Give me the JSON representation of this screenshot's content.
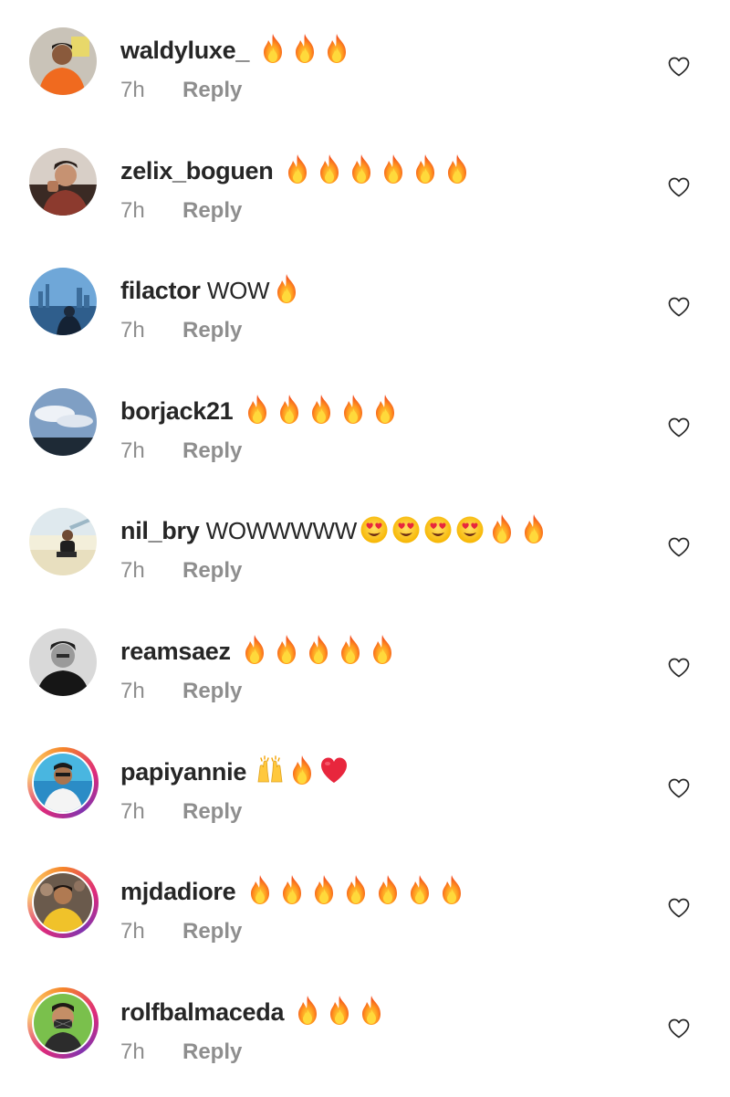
{
  "heart_color": "#262626",
  "muted_color": "#8e8e8e",
  "comments": [
    {
      "username": "waldyluxe_",
      "text": "",
      "emojis": [
        "fire",
        "fire",
        "fire"
      ],
      "time": "7h",
      "reply": "Reply",
      "story": false
    },
    {
      "username": "zelix_boguen",
      "text": "",
      "emojis": [
        "fire",
        "fire",
        "fire",
        "fire",
        "fire",
        "fire"
      ],
      "time": "7h",
      "reply": "Reply",
      "story": false
    },
    {
      "username": "filactor",
      "text": "WOW",
      "emojis": [
        "fire"
      ],
      "time": "7h",
      "reply": "Reply",
      "story": false
    },
    {
      "username": "borjack21",
      "text": "",
      "emojis": [
        "fire",
        "fire",
        "fire",
        "fire",
        "fire"
      ],
      "time": "7h",
      "reply": "Reply",
      "story": false
    },
    {
      "username": "nil_bry",
      "text": "WOWWWWW",
      "emojis": [
        "heart-eyes",
        "heart-eyes",
        "heart-eyes",
        "heart-eyes",
        "fire",
        "fire"
      ],
      "time": "7h",
      "reply": "Reply",
      "story": false
    },
    {
      "username": "reamsaez",
      "text": "",
      "emojis": [
        "fire",
        "fire",
        "fire",
        "fire",
        "fire"
      ],
      "time": "7h",
      "reply": "Reply",
      "story": false
    },
    {
      "username": "papiyannie",
      "text": "",
      "emojis": [
        "raising-hands",
        "fire",
        "red-heart"
      ],
      "time": "7h",
      "reply": "Reply",
      "story": true
    },
    {
      "username": "mjdadiore",
      "text": "",
      "emojis": [
        "fire",
        "fire",
        "fire",
        "fire",
        "fire",
        "fire",
        "fire"
      ],
      "time": "7h",
      "reply": "Reply",
      "story": true
    },
    {
      "username": "rolfbalmaceda",
      "text": "",
      "emojis": [
        "fire",
        "fire",
        "fire"
      ],
      "time": "7h",
      "reply": "Reply",
      "story": true
    }
  ]
}
